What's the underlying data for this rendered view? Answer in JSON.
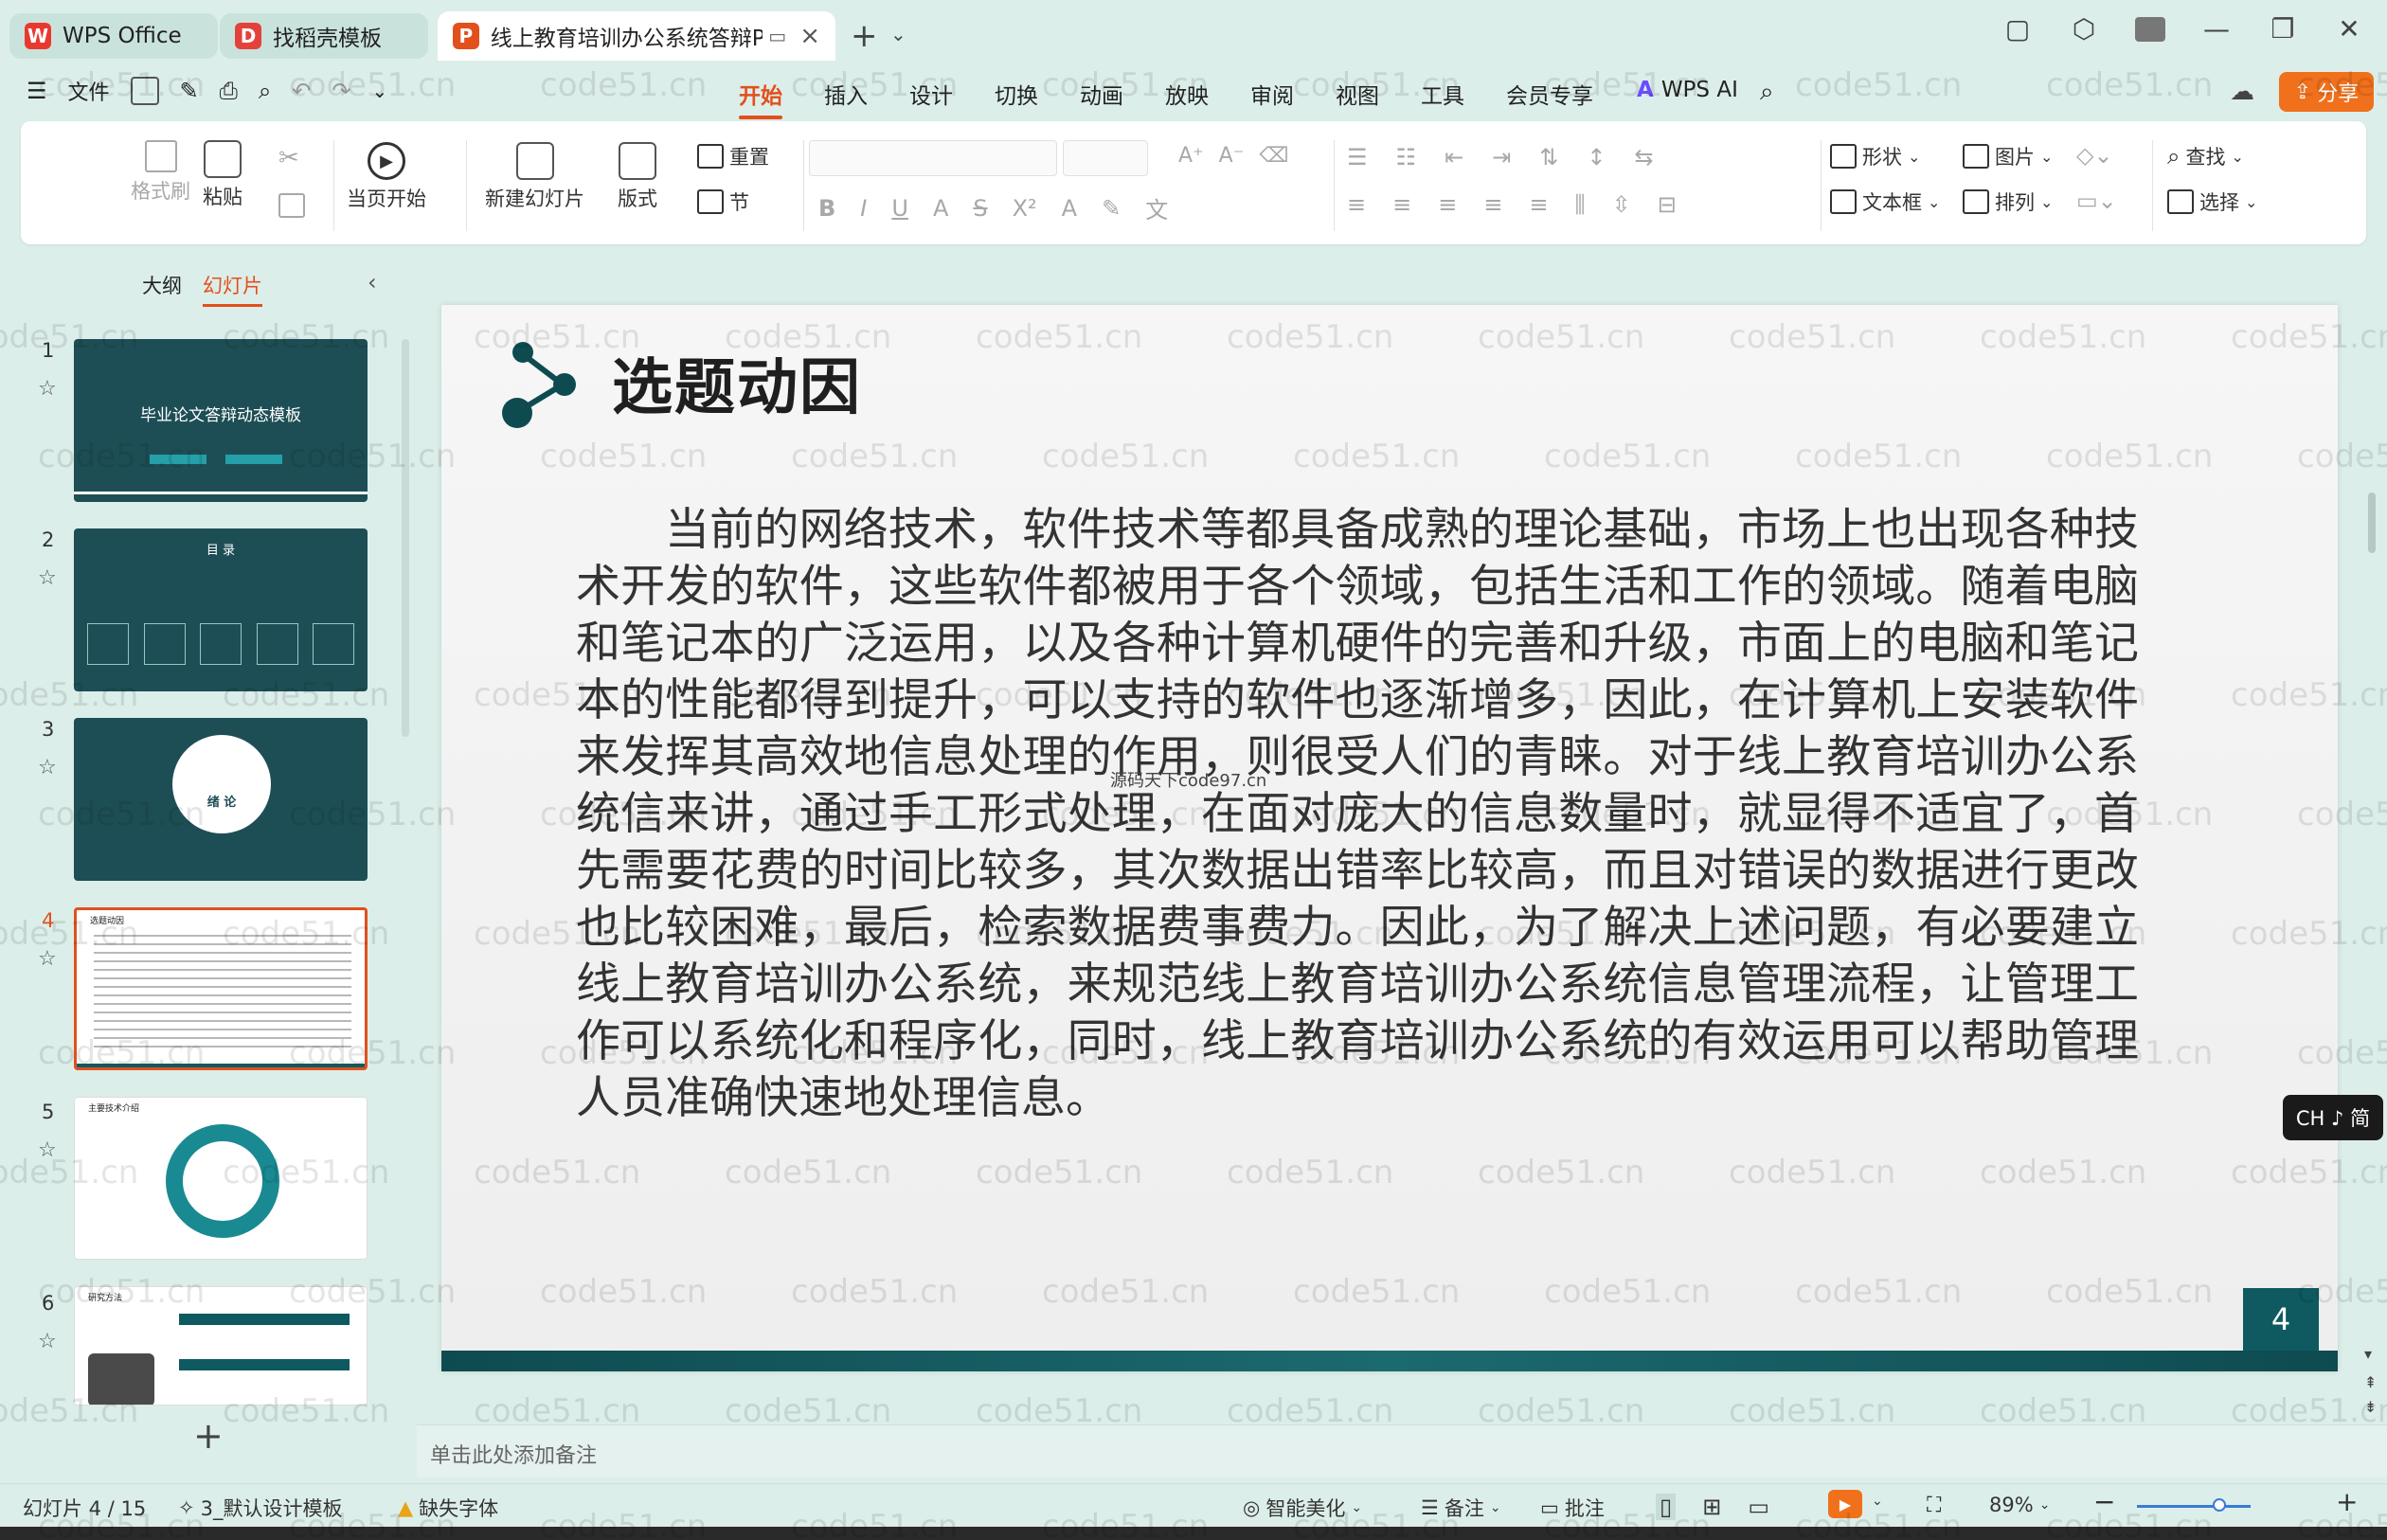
{
  "titlebar": {
    "tabs": [
      {
        "label": "WPS Office"
      },
      {
        "label": "找稻壳模板"
      },
      {
        "label": "线上教育培训办公系统答辩PP"
      }
    ]
  },
  "menu": {
    "file_label": "文件",
    "tabs": [
      "开始",
      "插入",
      "设计",
      "切换",
      "动画",
      "放映",
      "审阅",
      "视图",
      "工具",
      "会员专享"
    ],
    "wps_ai": "WPS AI",
    "share": "分享"
  },
  "ribbon": {
    "format_brush": "格式刷",
    "paste": "粘贴",
    "from_current": "当页开始",
    "new_slide": "新建幻灯片",
    "layout": "版式",
    "reset": "重置",
    "section": "节",
    "shape": "形状",
    "picture": "图片",
    "textbox": "文本框",
    "arrange": "排列",
    "find": "查找",
    "select": "选择"
  },
  "left_panel": {
    "tab_outline": "大纲",
    "tab_slides": "幻灯片",
    "slides": [
      {
        "num": "1",
        "title": "毕业论文答辩动态模板"
      },
      {
        "num": "2",
        "title": "目 录"
      },
      {
        "num": "3",
        "title": "绪 论"
      },
      {
        "num": "4",
        "title": "选题动因"
      },
      {
        "num": "5",
        "title": "主要技术介绍"
      },
      {
        "num": "6",
        "title": "研究方法"
      }
    ]
  },
  "slide": {
    "title": "选题动因",
    "body": "当前的网络技术，软件技术等都具备成熟的理论基础，市场上也出现各种技术开发的软件，这些软件都被用于各个领域，包括生活和工作的领域。随着电脑和笔记本的广泛运用，以及各种计算机硬件的完善和升级，市面上的电脑和笔记本的性能都得到提升，可以支持的软件也逐渐增多，因此，在计算机上安装软件来发挥其高效地信息处理的作用，则很受人们的青睐。对于线上教育培训办公系统信来讲，通过手工形式处理，在面对庞大的信息数量时，就显得不适宜了，首先需要花费的时间比较多，其次数据出错率比较高，而且对错误的数据进行更改也比较困难，最后，检索数据费事费力。因此，为了解决上述问题，有必要建立线上教育培训办公系统，来规范线上教育培训办公系统信息管理流程，让管理工作可以系统化和程序化，同时，线上教育培训办公系统的有效运用可以帮助管理人员准确快速地处理信息。",
    "page_number": "4",
    "inner_watermark": "源码天下code97.cn"
  },
  "ime": {
    "label": "CH ♪ 简"
  },
  "notes": {
    "placeholder": "单击此处添加备注"
  },
  "status": {
    "slide_counter": "幻灯片 4 / 15",
    "theme": "3_默认设计模板",
    "missing_font": "缺失字体",
    "beautify": "智能美化",
    "notes": "备注",
    "comment": "批注",
    "zoom": "89%"
  },
  "watermark_text": "code51.cn",
  "colors": {
    "accent": "#e2501c",
    "theme_dark": "#0e5a60",
    "share_bg": "#f0701c"
  }
}
